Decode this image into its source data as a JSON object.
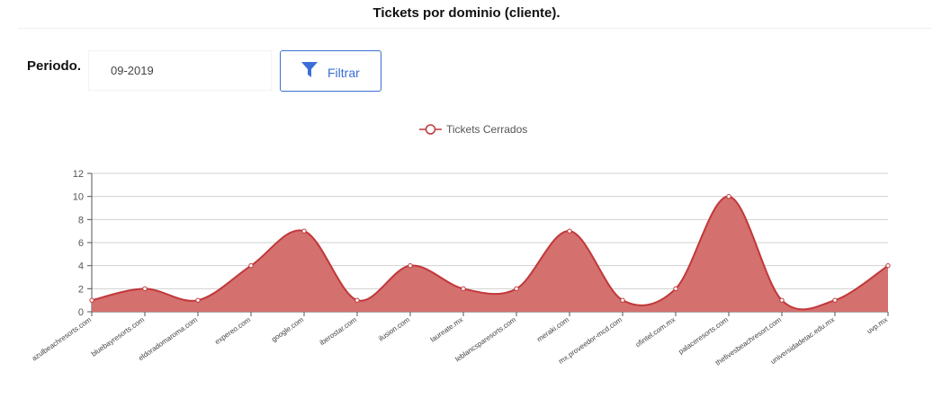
{
  "header": {
    "title": "Tickets por dominio (cliente)."
  },
  "filter": {
    "label": "Periodo.",
    "value": "09-2019",
    "button_label": "Filtrar",
    "button_icon": "filter-icon"
  },
  "colors": {
    "accent": "#3b6fd6",
    "series_line": "#c0383a",
    "series_fill": "#d4706e"
  },
  "chart_data": {
    "type": "area",
    "categories": [
      "azulbeachresorts.com",
      "bluebayresorts.com",
      "eldoradomaroma.com",
      "expereo.com",
      "google.com",
      "iberostar.com",
      "ilusion.com",
      "laureate.mx",
      "leblancsparesorts.com",
      "meraki.com",
      "mx.proveedor-mcd.com",
      "ofintel.com.mx",
      "palaceresorts.com",
      "thefivesbeachresort.com",
      "universidadetac.edu.mx",
      "uvp.mx"
    ],
    "series": [
      {
        "name": "Tickets Cerrados",
        "values": [
          1,
          2,
          1,
          4,
          7,
          1,
          4,
          2,
          2,
          7,
          1,
          2,
          10,
          1,
          1,
          4
        ]
      }
    ],
    "ylim": [
      0,
      12
    ],
    "yticks": [
      0,
      2,
      4,
      6,
      8,
      10,
      12
    ],
    "legend": "top-center",
    "grid": true,
    "xlabel": "",
    "ylabel": ""
  }
}
